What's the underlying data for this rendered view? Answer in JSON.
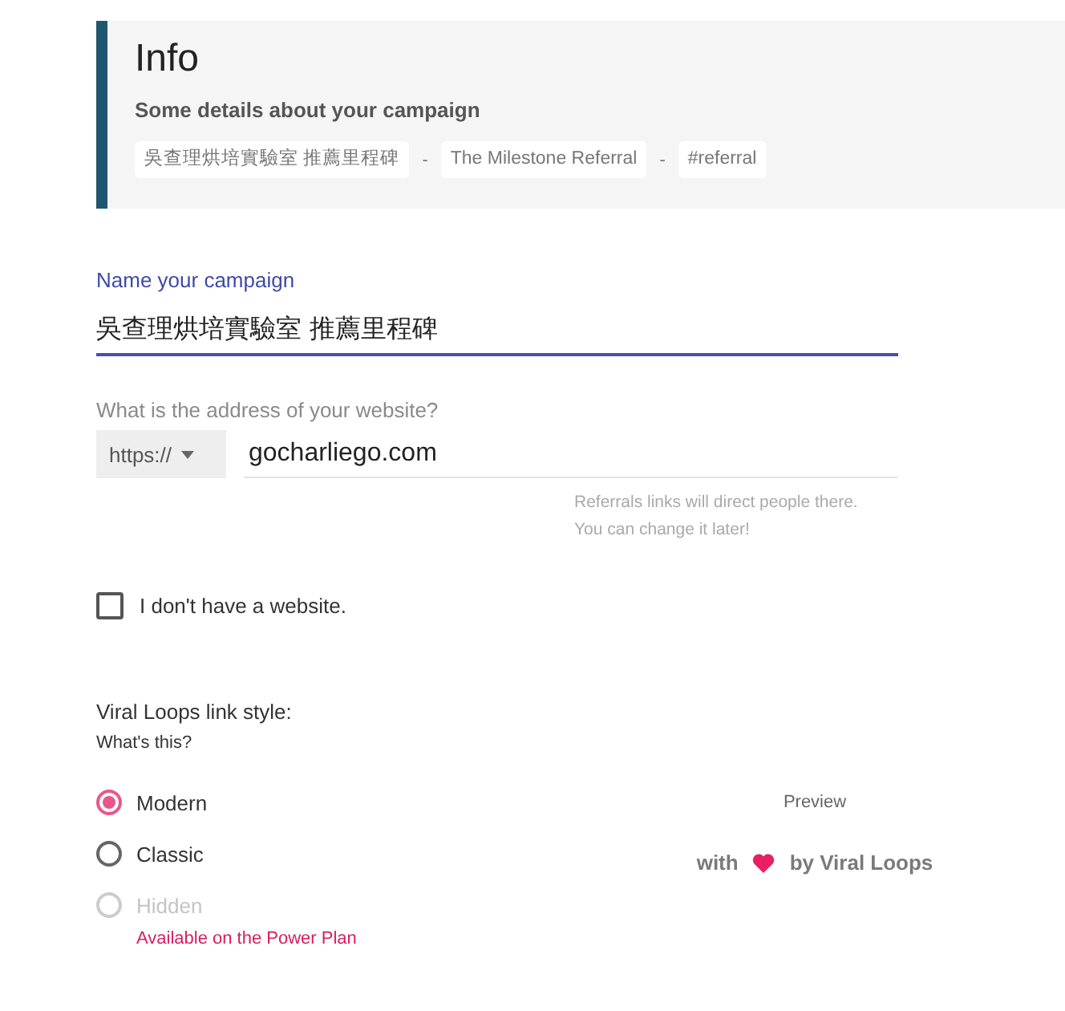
{
  "info": {
    "title": "Info",
    "subtitle": "Some details about your campaign",
    "breadcrumb": [
      {
        "kind": "tag",
        "text": "吳查理烘培實驗室 推薦里程碑"
      },
      {
        "kind": "separator",
        "text": "-"
      },
      {
        "kind": "tag",
        "text": "The Milestone Referral"
      },
      {
        "kind": "separator",
        "text": "-"
      },
      {
        "kind": "tag",
        "text": "#referral"
      }
    ]
  },
  "name_field": {
    "label": "Name your campaign",
    "value": "吳查理烘培實驗室 推薦里程碑",
    "focused": true
  },
  "website_field": {
    "label": "What is the address of your website?",
    "protocol": "https://",
    "value": "gocharliego.com",
    "focused": false,
    "help_lines": [
      "Referrals links will direct people there.",
      "You can change it later!"
    ]
  },
  "no_website": {
    "label": "I don't have a website.",
    "checked": false
  },
  "link_style": {
    "label": "Viral Loops link style:",
    "help_link": "What's this?",
    "options": [
      {
        "label": "Modern",
        "selected": true,
        "disabled": false
      },
      {
        "label": "Classic",
        "selected": false,
        "disabled": false
      },
      {
        "label": "Hidden",
        "selected": false,
        "disabled": true,
        "note": "Available on the Power Plan"
      }
    ]
  },
  "preview": {
    "label": "Preview",
    "badge_before": "with",
    "badge_after": "by Viral Loops"
  }
}
